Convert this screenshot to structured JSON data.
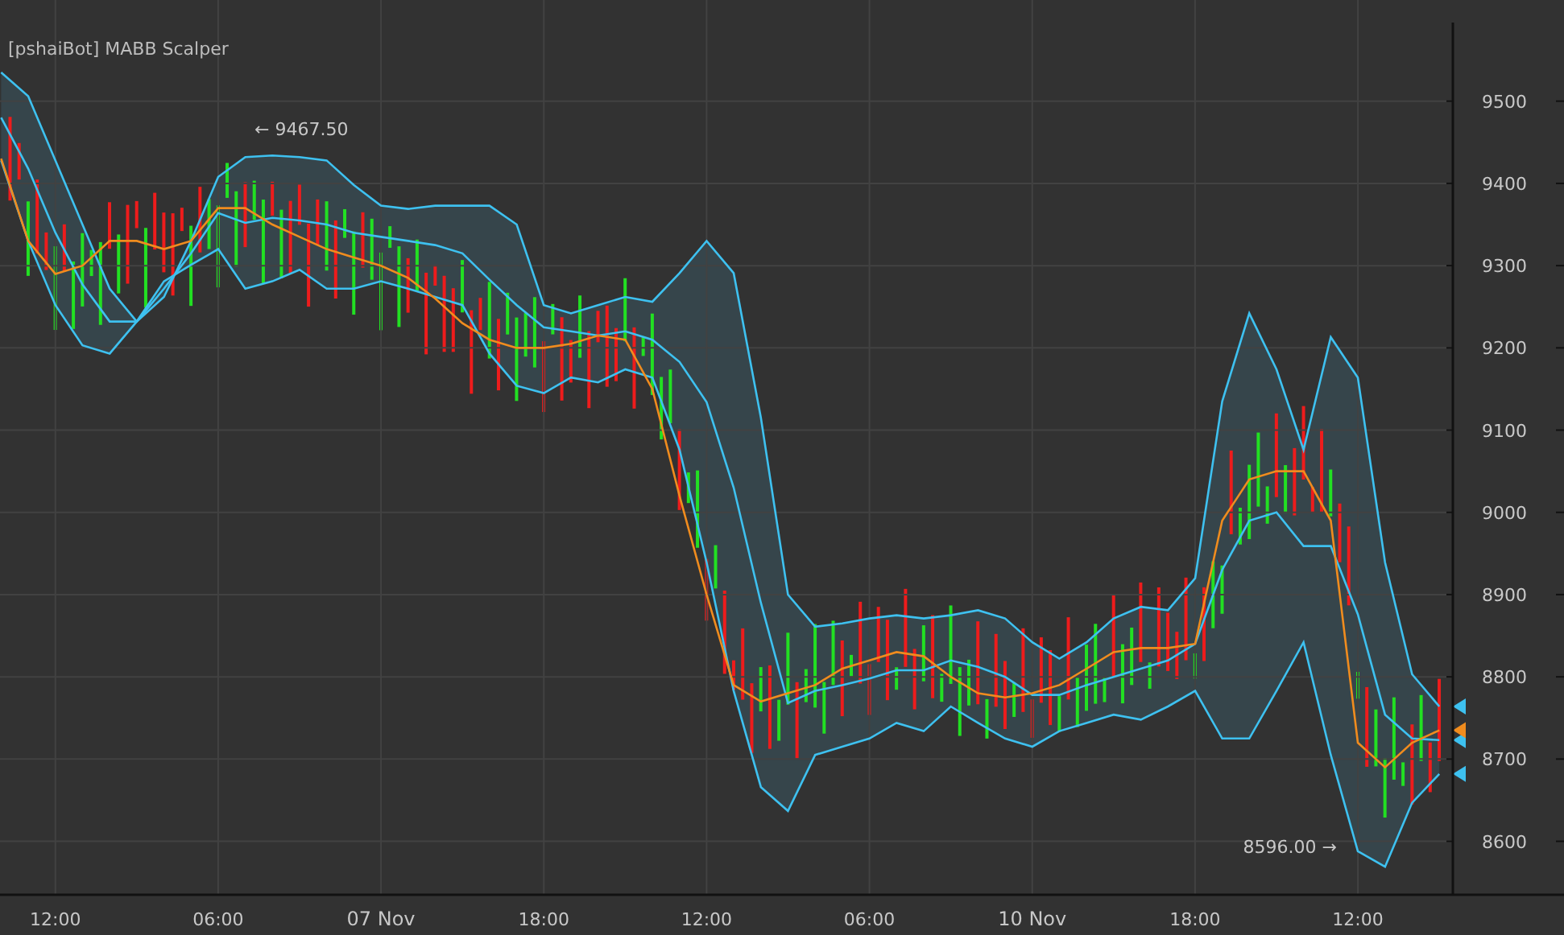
{
  "chart_data": {
    "type": "line",
    "title": "[pshaiBot] MABB Scalper",
    "categories": [
      null,
      null,
      "12:00",
      null,
      null,
      null,
      null,
      null,
      "06:00",
      null,
      null,
      null,
      null,
      null,
      "07 Nov",
      null,
      null,
      null,
      null,
      null,
      "18:00",
      null,
      null,
      null,
      null,
      null,
      "12:00",
      null,
      null,
      null,
      null,
      null,
      "06:00",
      null,
      null,
      null,
      null,
      null,
      "10 Nov",
      null,
      null,
      null,
      null,
      null,
      "18:00",
      null,
      null,
      null,
      null,
      null,
      "12:00",
      null,
      null,
      null
    ],
    "ylim": [
      8535,
      9623
    ],
    "yticks": [
      8600,
      8700,
      8800,
      8900,
      9000,
      9100,
      9200,
      9300,
      9400,
      9500
    ],
    "series": [
      {
        "color": "#3ec1f0",
        "values": [
          9535,
          9506,
          9428,
          9350,
          9272,
          9232,
          9262,
          9330,
          9408,
          9432,
          9434,
          9432,
          9428,
          9398,
          9373,
          9369,
          9373,
          9373,
          9373,
          9350,
          9252,
          9242,
          9252,
          9262,
          9256,
          9291,
          9330,
          9291,
          9115,
          8900,
          8861,
          8865,
          8871,
          8875,
          8871,
          8875,
          8881,
          8871,
          8842,
          8822,
          8842,
          8871,
          8885,
          8881,
          8920,
          9135,
          9242,
          9174,
          9076,
          9213,
          9164,
          8939,
          8803,
          8764
        ]
      },
      {
        "color": "#3ec1f0",
        "values": [
          9480,
          9418,
          9340,
          9277,
          9232,
          9232,
          9272,
          9315,
          9364,
          9352,
          9358,
          9355,
          9350,
          9340,
          9335,
          9330,
          9325,
          9315,
          9283,
          9252,
          9225,
          9220,
          9215,
          9220,
          9210,
          9183,
          9134,
          9030,
          8890,
          8768,
          8783,
          8790,
          8798,
          8808,
          8808,
          8820,
          8812,
          8800,
          8778,
          8778,
          8790,
          8800,
          8810,
          8820,
          8840,
          8930,
          8990,
          9000,
          8959,
          8959,
          8876,
          8754,
          8725,
          8723
        ]
      },
      {
        "color": "#3ec1f0",
        "values": [
          9428,
          9330,
          9252,
          9203,
          9193,
          9232,
          9281,
          9301,
          9320,
          9272,
          9281,
          9295,
          9272,
          9272,
          9281,
          9272,
          9262,
          9252,
          9193,
          9154,
          9145,
          9164,
          9158,
          9174,
          9164,
          9076,
          8939,
          8783,
          8666,
          8637,
          8705,
          8715,
          8725,
          8744,
          8734,
          8764,
          8744,
          8725,
          8715,
          8734,
          8744,
          8754,
          8748,
          8764,
          8783,
          8725,
          8725,
          8783,
          8842,
          8705,
          8588,
          8569,
          8647,
          8682
        ]
      },
      {
        "color": "#f08c1e",
        "values": [
          9430,
          9330,
          9290,
          9300,
          9330,
          9330,
          9320,
          9330,
          9370,
          9370,
          9350,
          9335,
          9320,
          9310,
          9300,
          9285,
          9260,
          9230,
          9210,
          9200,
          9200,
          9205,
          9215,
          9210,
          9150,
          9020,
          8900,
          8790,
          8770,
          8780,
          8790,
          8810,
          8820,
          8830,
          8825,
          8800,
          8780,
          8775,
          8780,
          8790,
          8810,
          8830,
          8835,
          8835,
          8840,
          8990,
          9040,
          9050,
          9050,
          8990,
          8720,
          8690,
          8720,
          8735
        ]
      }
    ],
    "grid": true,
    "annotations": [
      "← 9467.50",
      "8596.00 →"
    ]
  }
}
